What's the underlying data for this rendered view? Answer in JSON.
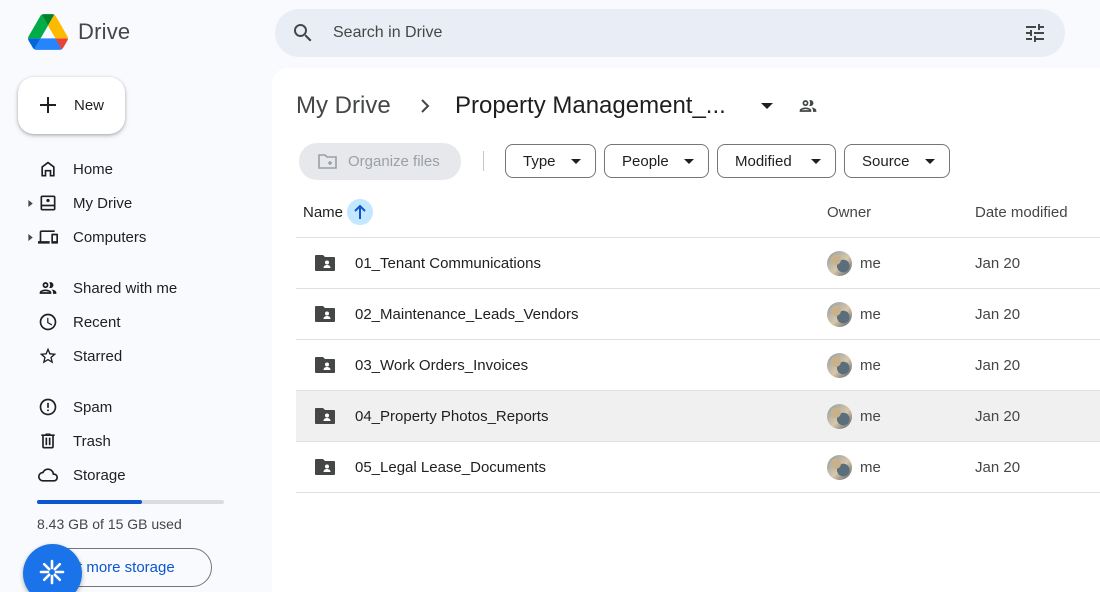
{
  "app": {
    "name": "Drive"
  },
  "search": {
    "placeholder": "Search in Drive"
  },
  "new_button": {
    "label": "New"
  },
  "sidebar": {
    "items": [
      {
        "label": "Home",
        "icon": "home-icon",
        "expandable": false
      },
      {
        "label": "My Drive",
        "icon": "my-drive-icon",
        "expandable": true
      },
      {
        "label": "Computers",
        "icon": "computers-icon",
        "expandable": true
      },
      {
        "label": "Shared with me",
        "icon": "shared-with-me-icon",
        "expandable": false
      },
      {
        "label": "Recent",
        "icon": "recent-clock-icon",
        "expandable": false
      },
      {
        "label": "Starred",
        "icon": "star-icon",
        "expandable": false
      },
      {
        "label": "Spam",
        "icon": "spam-icon",
        "expandable": false
      },
      {
        "label": "Trash",
        "icon": "trash-icon",
        "expandable": false
      },
      {
        "label": "Storage",
        "icon": "cloud-icon",
        "expandable": false
      }
    ],
    "storage": {
      "used_text": "8.43 GB of 15 GB used",
      "used_fraction": 0.562,
      "button_label": "Get more storage",
      "visible_button_text": "t more storage"
    }
  },
  "breadcrumb": {
    "root": "My Drive",
    "current": "Property Management_..."
  },
  "toolbar": {
    "organize_label": "Organize files",
    "filters": [
      "Type",
      "People",
      "Modified",
      "Source"
    ]
  },
  "table": {
    "columns": {
      "name": "Name",
      "owner": "Owner",
      "date": "Date modified"
    },
    "rows": [
      {
        "name": "01_Tenant Communications",
        "owner": "me",
        "date": "Jan 20",
        "highlighted": false
      },
      {
        "name": "02_Maintenance_Leads_Vendors",
        "owner": "me",
        "date": "Jan 20",
        "highlighted": false
      },
      {
        "name": "03_Work Orders_Invoices",
        "owner": "me",
        "date": "Jan 20",
        "highlighted": false
      },
      {
        "name": "04_Property Photos_Reports",
        "owner": "me",
        "date": "Jan 20",
        "highlighted": true
      },
      {
        "name": "05_Legal Lease_Documents",
        "owner": "me",
        "date": "Jan 20",
        "highlighted": false
      }
    ]
  },
  "colors": {
    "accent": "#0b57d0",
    "sort_chip": "#c2e7ff",
    "search_bg": "#e9eef6",
    "fab": "#1a73e8"
  }
}
